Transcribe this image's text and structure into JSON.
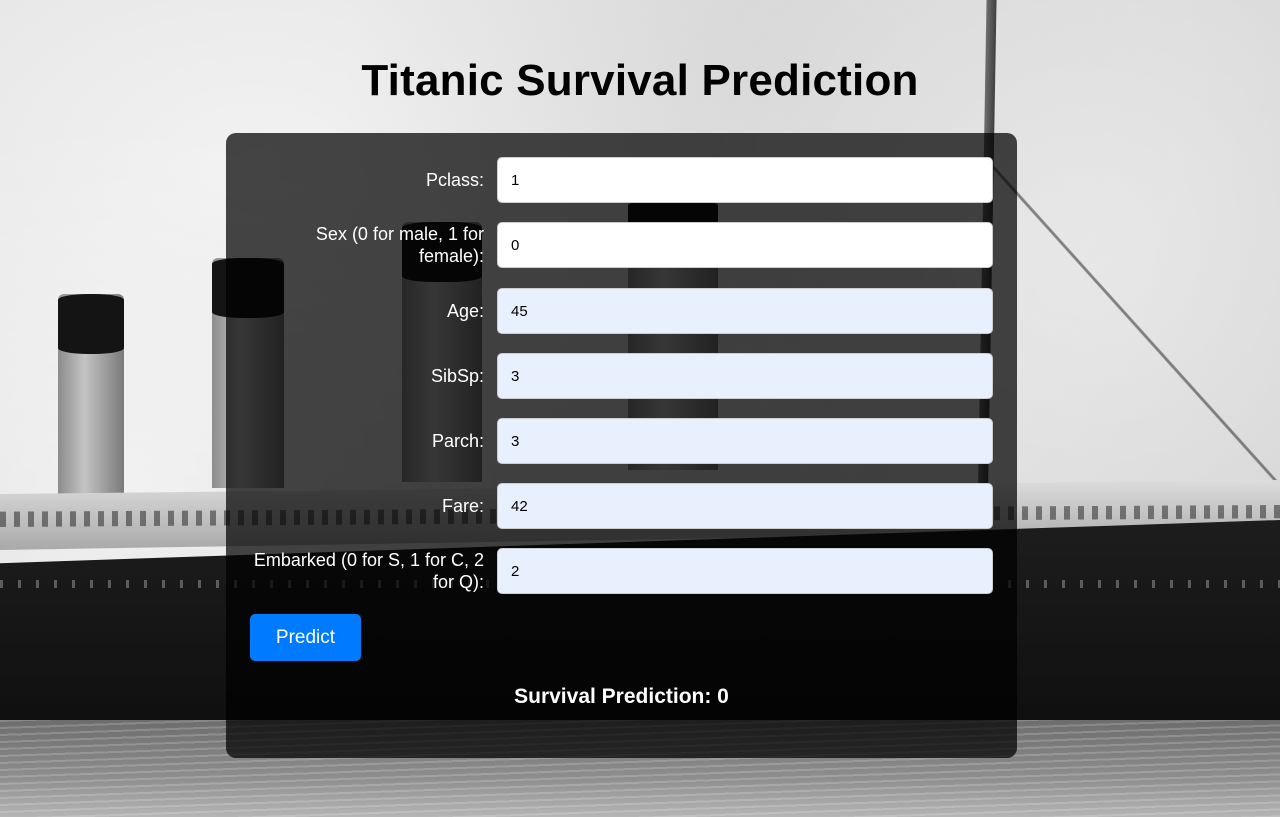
{
  "page": {
    "title": "Titanic Survival Prediction"
  },
  "form": {
    "fields": [
      {
        "label": "Pclass:",
        "value": "1",
        "autofilled": false
      },
      {
        "label": "Sex (0 for male, 1 for female):",
        "value": "0",
        "autofilled": false
      },
      {
        "label": "Age:",
        "value": "45",
        "autofilled": true
      },
      {
        "label": "SibSp:",
        "value": "3",
        "autofilled": true
      },
      {
        "label": "Parch:",
        "value": "3",
        "autofilled": true
      },
      {
        "label": "Fare:",
        "value": "42",
        "autofilled": true
      },
      {
        "label": "Embarked (0 for S, 1 for C, 2 for Q):",
        "value": "2",
        "autofilled": true
      }
    ],
    "submit_label": "Predict"
  },
  "result": {
    "text": "Survival Prediction: 0"
  },
  "colors": {
    "button": "#007bff",
    "card_overlay": "rgba(0,0,0,0.72)",
    "autofill_bg": "#e8f0fe",
    "input_bg": "#ffffff"
  }
}
